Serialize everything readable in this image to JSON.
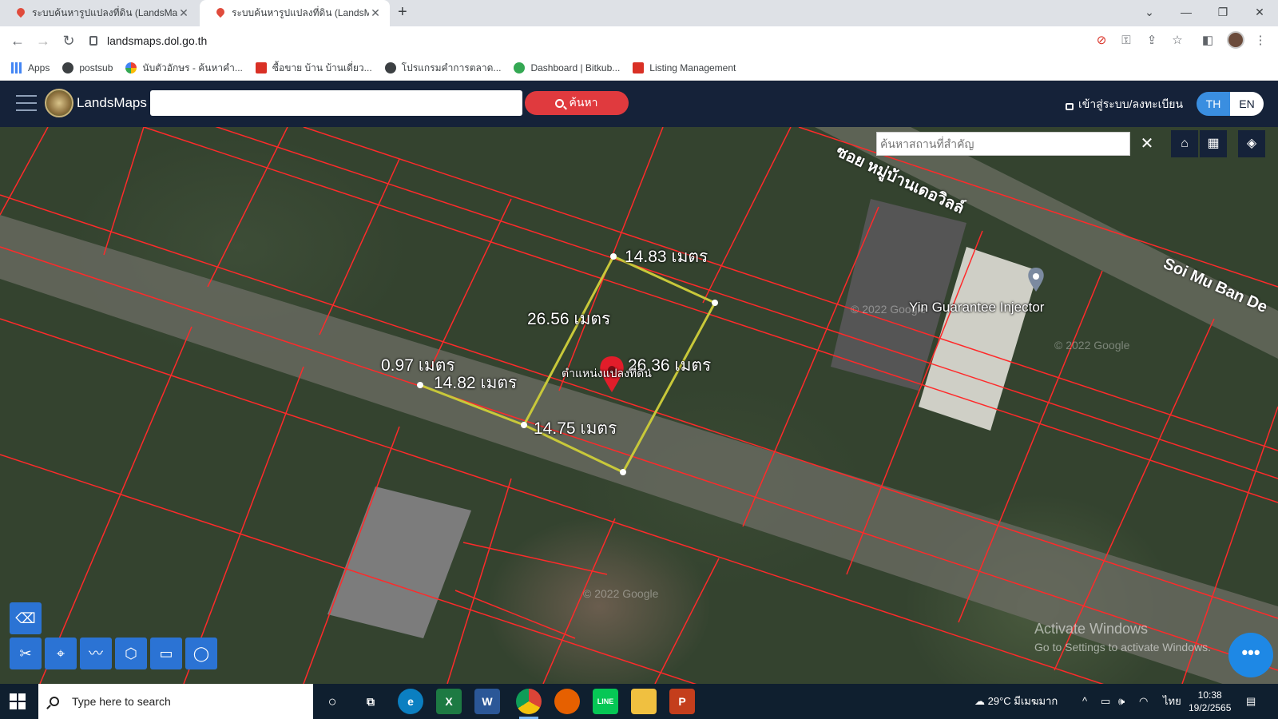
{
  "browser": {
    "tabs": [
      {
        "title": "ระบบค้นหารูปแปลงที่ดิน (LandsMaps)"
      },
      {
        "title": "ระบบค้นหารูปแปลงที่ดิน (LandsMaps)"
      }
    ],
    "url": "landsmaps.dol.go.th",
    "bookmarks": [
      {
        "label": "Apps",
        "icon": "apps-grid-icon",
        "color": "#4285f4"
      },
      {
        "label": "postsub",
        "icon": "globe-icon",
        "color": "#3c4043"
      },
      {
        "label": "นับตัวอักษร - ค้นหาคำ...",
        "icon": "google-g-icon",
        "color": "#4285f4"
      },
      {
        "label": "ซื้อขาย บ้าน บ้านเดี่ยว...",
        "icon": "house-logo-icon",
        "color": "#d93025"
      },
      {
        "label": "โปรแกรมคำการตลาด...",
        "icon": "globe-icon",
        "color": "#3c4043"
      },
      {
        "label": "Dashboard | Bitkub...",
        "icon": "bitkub-icon",
        "color": "#34a853"
      },
      {
        "label": "Listing Management",
        "icon": "house-logo-icon",
        "color": "#d93025"
      }
    ]
  },
  "app": {
    "brand": "LandsMaps",
    "search_value": "",
    "search_button": "ค้นหา",
    "login": "เข้าสู่ระบบ/ลงทะเบียน",
    "lang_th": "TH",
    "lang_en": "EN",
    "place_search_placeholder": "ค้นหาสถานที่สำคัญ",
    "accent": "#e03a3e",
    "header_bg": "#152239"
  },
  "map": {
    "measurements": [
      "14.83 เมตร",
      "26.56 เมตร",
      "26.36 เมตร",
      "0.97 เมตร",
      "14.82 เมตร",
      "14.75 เมตร"
    ],
    "marker_label": "ตำแหน่งแปลงที่ดิน",
    "road_thai": "ซอย หมู่บ้านเดอวิลล์",
    "road_en": "Soi Mu Ban De",
    "poi": "Yin Guarantee Injector",
    "watermark": [
      "© 2022 Google",
      "© 2022 Google",
      "© 2022 Google"
    ],
    "parcel_line_color": "#ff2a2a",
    "measure_line_color": "#c8c83a"
  },
  "windows": {
    "activate_title": "Activate Windows",
    "activate_sub": "Go to Settings to activate Windows.",
    "taskbar_search": "Type here to search",
    "weather": "29°C มีเมฆมาก",
    "lang": "ไทย",
    "time": "10:38",
    "date": "19/2/2565"
  }
}
